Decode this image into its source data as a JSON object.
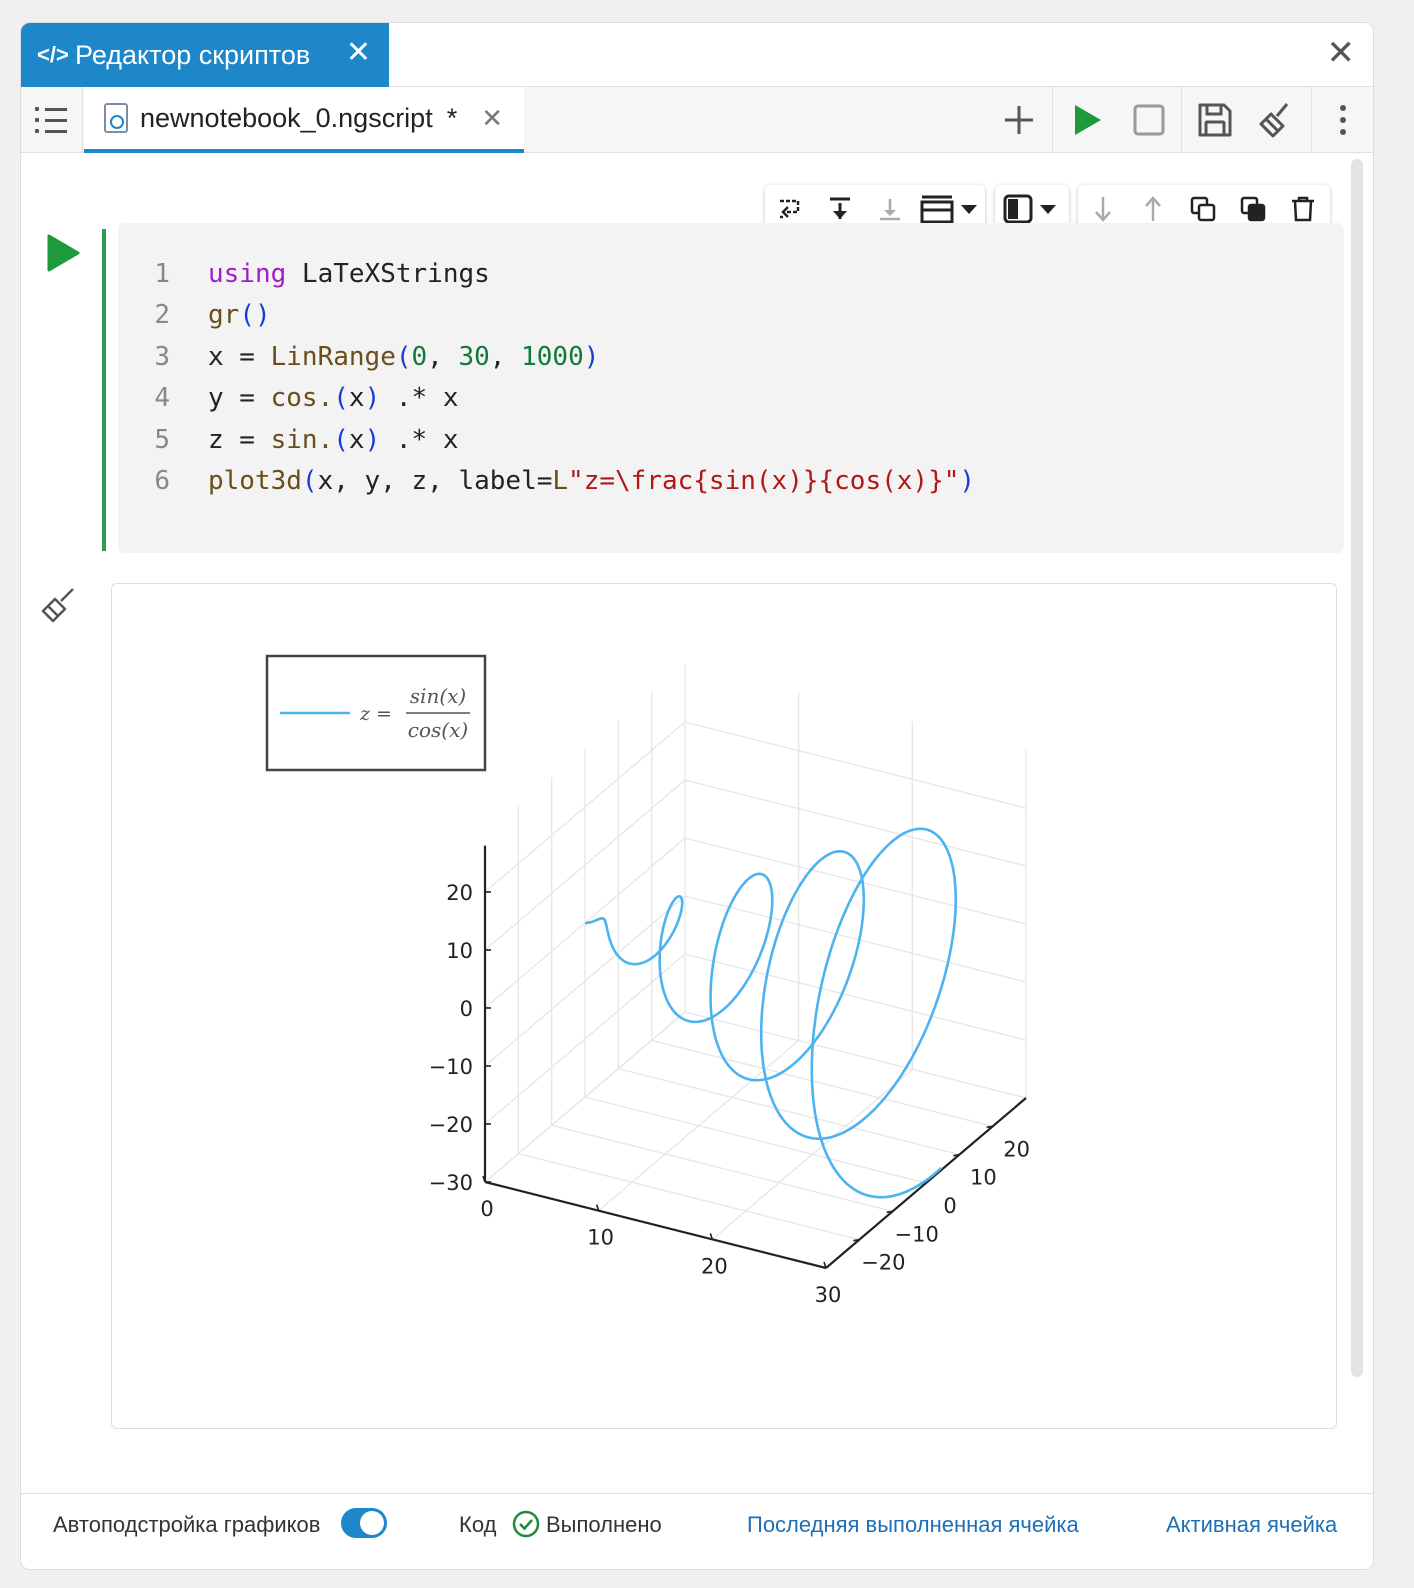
{
  "header": {
    "tab_title": "Редактор скриптов"
  },
  "file_tab": {
    "name": "newnotebook_0.ngscript",
    "modified": "*"
  },
  "code": {
    "lines": [
      {
        "n": "1"
      },
      {
        "n": "2"
      },
      {
        "n": "3"
      },
      {
        "n": "4"
      },
      {
        "n": "5"
      },
      {
        "n": "6"
      }
    ],
    "tokens": {
      "l1": [
        "using",
        " LaTeXStrings"
      ],
      "l2": [
        "gr",
        "()"
      ],
      "l3": [
        "x = ",
        "LinRange",
        "(",
        "0",
        ", ",
        "30",
        ", ",
        "1000",
        ")"
      ],
      "l4": [
        "y = ",
        "cos.",
        "(",
        "x",
        ")",
        " .* x"
      ],
      "l5": [
        "z = ",
        "sin.",
        "(",
        "x",
        ")",
        " .* x"
      ],
      "l6": [
        "plot3d",
        "(",
        "x, y, z, label=",
        "L",
        "\"z=\\frac{sin(x)}{cos(x)}\"",
        ")"
      ]
    }
  },
  "chart_data": {
    "type": "line3d",
    "legend": {
      "entry_lhs": "z =",
      "numerator": "sin(x)",
      "denominator": "cos(x)",
      "placement": "top-left"
    },
    "series_color": "#4db3f0",
    "x_ticks": [
      "0",
      "10",
      "20",
      "30"
    ],
    "y_ticks": [
      "−20",
      "−10",
      "0",
      "10",
      "20"
    ],
    "z_ticks": [
      "−30",
      "−20",
      "−10",
      "0",
      "10",
      "20"
    ],
    "x_range": [
      0,
      30
    ],
    "y_range": [
      -30,
      30
    ],
    "z_range": [
      -30,
      30
    ],
    "x": "LinRange(0, 30, 1000)",
    "y": "cos.(x) .* x",
    "z": "sin.(x) .* x",
    "grid": true
  },
  "status": {
    "autofit_label": "Автоподстройка графиков",
    "code_label": "Код",
    "done_label": "Выполнено",
    "last_cell_link": "Последняя выполненная ячейка",
    "active_cell_link": "Активная ячейка"
  },
  "colors": {
    "accent": "#1e87c9",
    "run_green": "#1f9a3a",
    "cell_bar": "#2e9a56"
  }
}
